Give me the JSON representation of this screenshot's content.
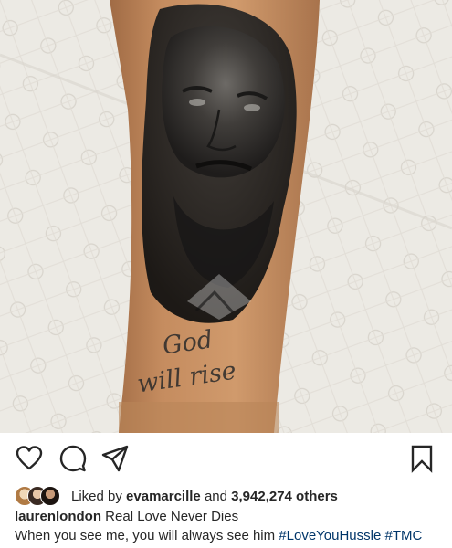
{
  "photo": {
    "tattoo_line1": "God",
    "tattoo_line2": "will rise"
  },
  "actions": {
    "like": "heart-icon",
    "comment": "comment-icon",
    "share": "share-icon",
    "save": "bookmark-icon"
  },
  "likes": {
    "prefix": "Liked by",
    "liker": "evamarcille",
    "and": "and",
    "others": "3,942,274 others"
  },
  "caption": {
    "username": "laurenlondon",
    "text": "Real Love Never Dies"
  },
  "comment": {
    "text": "When you see me, you will always see him",
    "hashtag1": "#LoveYouHussle",
    "hashtag2": "#TMC"
  }
}
